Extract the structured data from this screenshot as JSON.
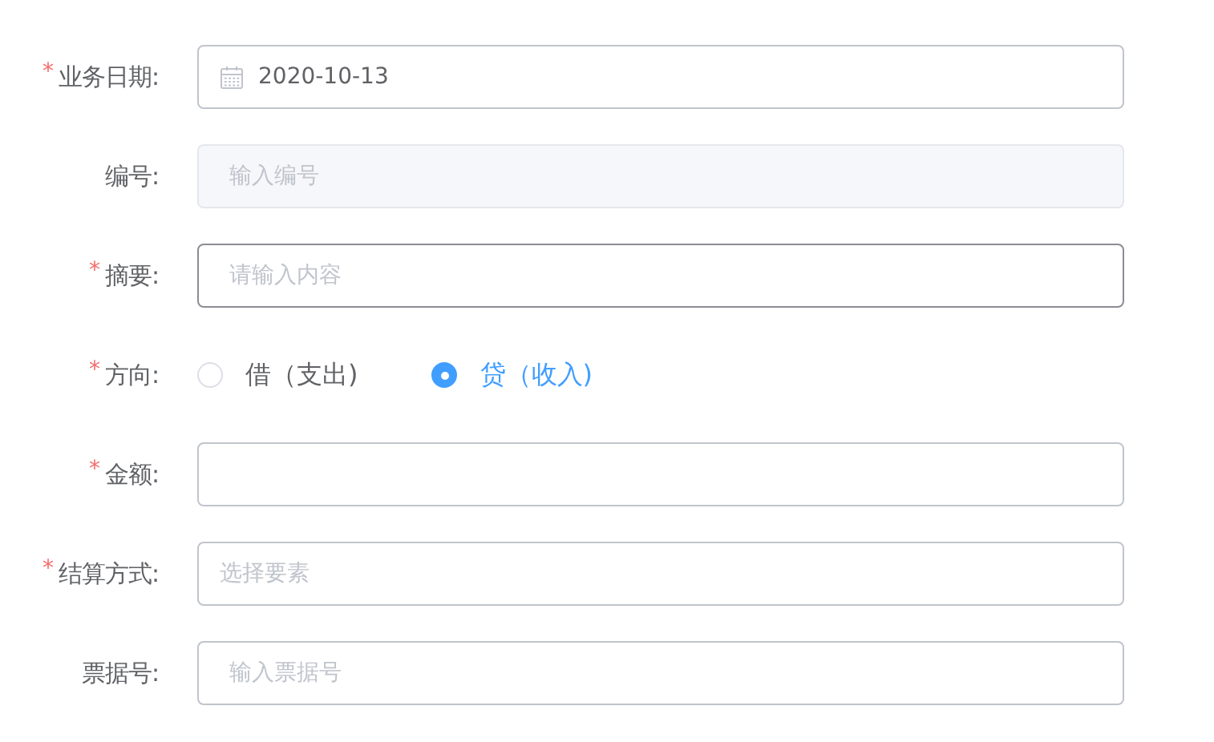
{
  "form": {
    "rows": [
      {
        "label": "业务日期:",
        "required_mark": "*",
        "field": {
          "kind": "date",
          "value": "2020-10-13"
        }
      },
      {
        "label": "编号:",
        "field": {
          "kind": "input",
          "placeholder": "输入编号",
          "disabled": true,
          "focused": false
        }
      },
      {
        "label": "摘要:",
        "required_mark": "*",
        "field": {
          "kind": "input",
          "placeholder": "请输入内容",
          "disabled": false,
          "focused": true
        }
      },
      {
        "label": "方向:",
        "required_mark": "*",
        "field": {
          "kind": "radio",
          "options": [
            {
              "label": "借（支出)",
              "selected": false
            },
            {
              "label": "贷（收入)",
              "selected": true
            }
          ]
        }
      },
      {
        "label": "金额:",
        "required_mark": "*",
        "field": {
          "kind": "input",
          "disabled": false,
          "focused": false
        }
      },
      {
        "label": "结算方式:",
        "required_mark": "*",
        "field": {
          "kind": "select",
          "placeholder": "选择要素"
        }
      },
      {
        "label": "票据号:",
        "field": {
          "kind": "input",
          "placeholder": "输入票据号",
          "disabled": false,
          "focused": false
        }
      }
    ]
  }
}
